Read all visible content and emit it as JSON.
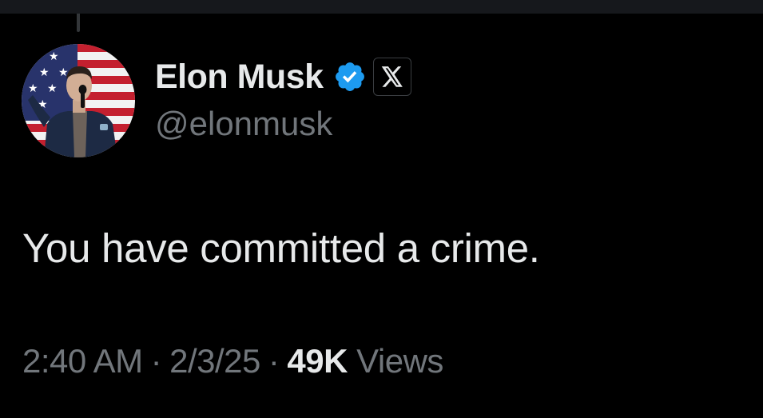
{
  "post": {
    "author": {
      "display_name": "Elon Musk",
      "handle": "@elonmusk",
      "verified_icon": "verified-badge-icon",
      "affiliate_icon": "x-logo-icon"
    },
    "text": "You have committed a crime.",
    "meta": {
      "time": "2:40 AM",
      "date": "2/3/25",
      "separator": "·",
      "views_count": "49K",
      "views_label": "Views"
    }
  },
  "colors": {
    "background": "#000000",
    "primary_text": "#e7e9ea",
    "secondary_text": "#71767b",
    "verified_blue": "#1d9bf0"
  }
}
